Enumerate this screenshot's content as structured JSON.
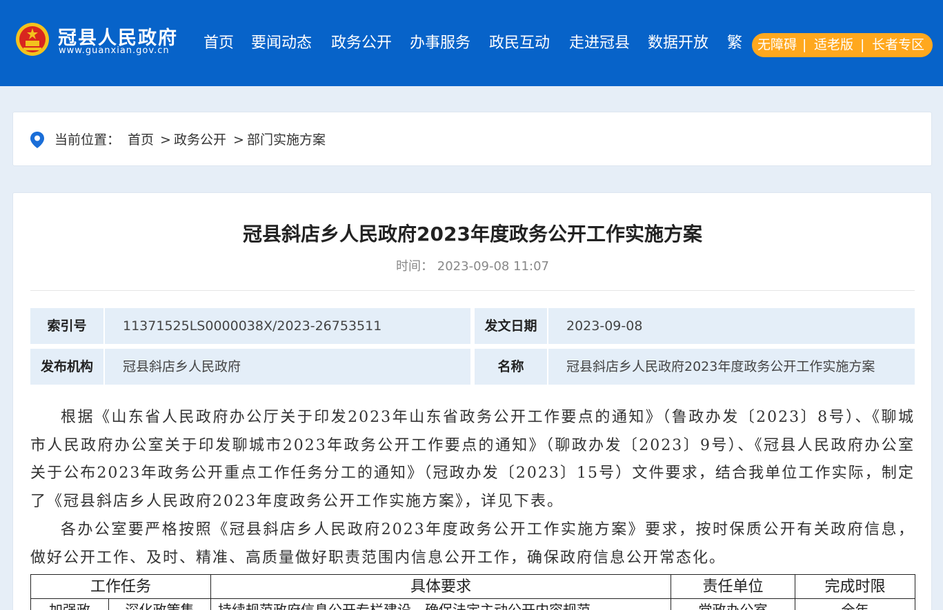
{
  "header": {
    "site_name": "冠县人民政府",
    "site_domain": "www.guanxian.gov.cn",
    "nav": [
      "首页",
      "要闻动态",
      "政务公开",
      "办事服务",
      "政民互动",
      "走进冠县",
      "数据开放",
      "繁"
    ],
    "access": [
      "无障碍",
      "适老版",
      "长者专区"
    ],
    "access_sep": "|",
    "colors": {
      "header_bg": "#0763c9",
      "access_bg": "#ffa81e"
    }
  },
  "breadcrumb": {
    "label": "当前位置：",
    "items": [
      "首页",
      "政务公开",
      "部门实施方案"
    ],
    "sep": ">"
  },
  "article": {
    "title": "冠县斜店乡人民政府2023年度政务公开工作实施方案",
    "time_label": "时间：",
    "time_value": "2023-09-08 11:07"
  },
  "meta": {
    "index_label": "索引号",
    "index_value": "11371525LS0000038X/2023-26753511",
    "date_label": "发文日期",
    "date_value": "2023-09-08",
    "org_label": "发布机构",
    "org_value": "冠县斜店乡人民政府",
    "name_label": "名称",
    "name_value": "冠县斜店乡人民政府2023年度政务公开工作实施方案"
  },
  "body": {
    "para1": "根据《山东省人民政府办公厅关于印发2023年山东省政务公开工作要点的通知》（鲁政办发〔2023〕8号）、《聊城市人民政府办公室关于印发聊城市2023年政务公开工作要点的通知》（聊政办发〔2023〕9号）、《冠县人民政府办公室关于公布2023年政务公开重点工作任务分工的通知》（冠政办发〔2023〕15号）文件要求，结合我单位工作实际，制定了《冠县斜店乡人民政府2023年度政务公开工作实施方案》，详见下表。",
    "para2": "各办公室要严格按照《冠县斜店乡人民政府2023年度政务公开工作实施方案》要求，按时保质公开有关政府信息，做好公开工作、及时、精准、高质量做好职责范围内信息公开工作，确保政府信息公开常态化。"
  },
  "table": {
    "headers": [
      "工作任务",
      "具体要求",
      "责任单位",
      "完成时限"
    ],
    "row1": [
      "加强政",
      "深化政策集",
      "持续规范政府信息公开专栏建设，确保法定主动公开内容规范",
      "党政办公室",
      "全年"
    ]
  }
}
